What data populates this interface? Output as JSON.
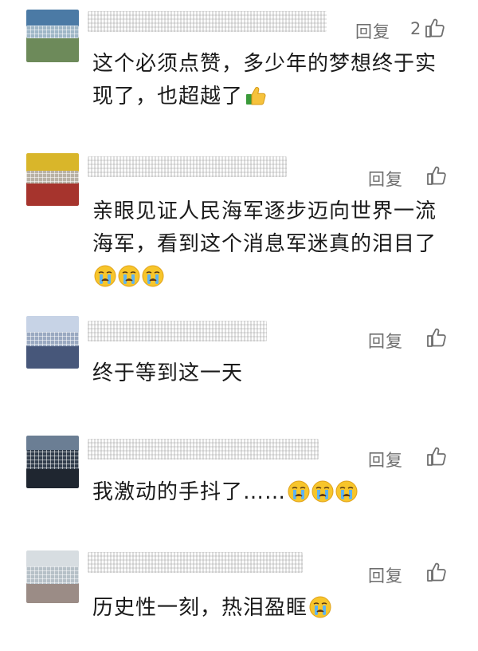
{
  "reply_label": "回复",
  "comments": [
    {
      "likes": "2",
      "text": "这个必须点赞，多少年的梦想终于实现了，也超越了",
      "emoji": [
        "thumbs-up"
      ]
    },
    {
      "likes": "",
      "text": "亲眼见证人民海军逐步迈向世界一流海军，看到这个消息军迷真的泪目了",
      "emoji": [
        "crying-face",
        "crying-face",
        "crying-face"
      ]
    },
    {
      "likes": "",
      "text": "终于等到这一天",
      "emoji": []
    },
    {
      "likes": "",
      "text": "我激动的手抖了……",
      "emoji": [
        "crying-face",
        "crying-face",
        "crying-face"
      ]
    },
    {
      "likes": "",
      "text": "历史性一刻，热泪盈眶",
      "emoji": [
        "crying-face"
      ]
    }
  ],
  "colors": {
    "reply_text": "#6f6f6f",
    "body_text": "#1a1a1a",
    "background": "#ffffff"
  }
}
